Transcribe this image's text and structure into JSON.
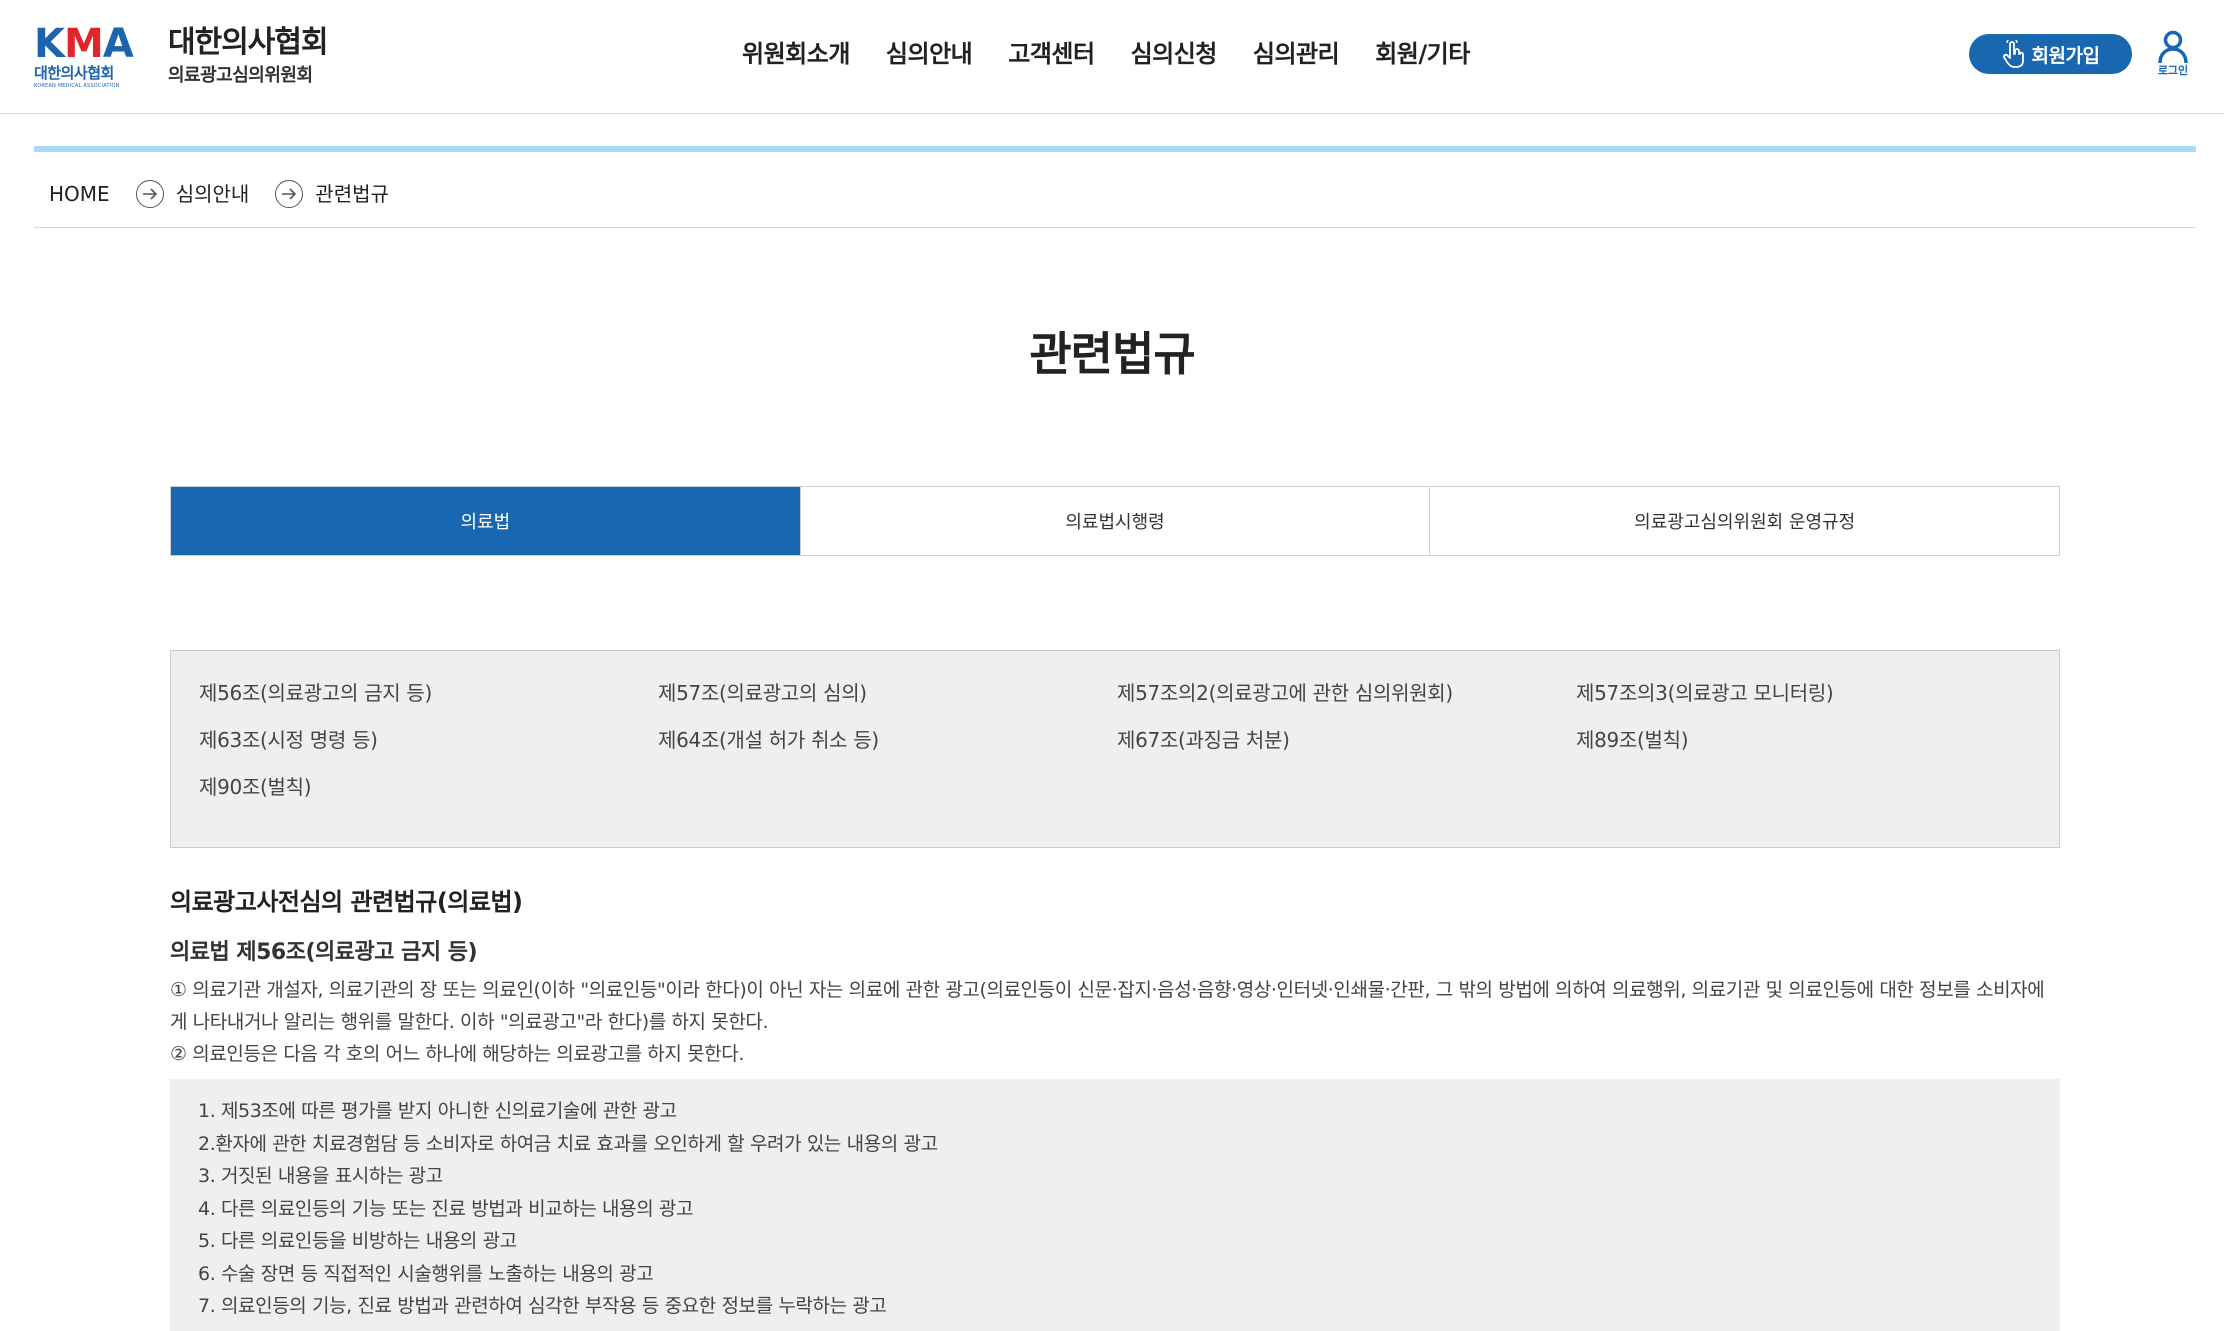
{
  "header": {
    "logo": {
      "abbr_left": "K",
      "abbr_mid": "M",
      "abbr_right": "A",
      "korean": "대한의사협회",
      "english": "KOREAN MEDICAL ASSOCIATION"
    },
    "org_title": "대한의사협회",
    "org_subtitle": "의료광고심의위원회",
    "nav": [
      "위원회소개",
      "심의안내",
      "고객센터",
      "심의신청",
      "심의관리",
      "회원/기타"
    ],
    "join_label": "회원가입",
    "login_label": "로그인",
    "colors": {
      "brand": "#1a67b1",
      "logo_red": "#e0262b",
      "crumb_bar": "#a9dbf5"
    }
  },
  "breadcrumb": [
    "HOME",
    "심의안내",
    "관련법규"
  ],
  "page_title": "관련법규",
  "tabs": [
    {
      "label": "의료법",
      "active": true
    },
    {
      "label": "의료법시행령",
      "active": false
    },
    {
      "label": "의료광고심의위원회 운영규정",
      "active": false
    }
  ],
  "articles": [
    "제56조(의료광고의 금지 등)",
    "제57조(의료광고의 심의)",
    "제57조의2(의료광고에 관한 심의위원회)",
    "제57조의3(의료광고 모니터링)",
    "제63조(시정 명령 등)",
    "제64조(개설 허가 취소 등)",
    "제67조(과징금 처분)",
    "제89조(벌칙)",
    "제90조(벌칙)"
  ],
  "content": {
    "section_title": "의료광고사전심의 관련법규(의료법)",
    "law_title": "의료법 제56조(의료광고 금지 등)",
    "para1": "① 의료기관 개설자, 의료기관의 장 또는 의료인(이하 \"의료인등\"이라 한다)이 아닌 자는 의료에 관한 광고(의료인등이 신문·잡지·음성·음향·영상·인터넷·인쇄물·간판, 그 밖의 방법에 의하여 의료행위, 의료기관 및 의료인등에 대한 정보를 소비자에게 나타내거나 알리는 행위를 말한다. 이하 \"의료광고\"라 한다)를 하지 못한다.",
    "para2": "② 의료인등은 다음 각 호의 어느 하나에 해당하는 의료광고를 하지 못한다.",
    "items": [
      "1. 제53조에 따른 평가를 받지 아니한 신의료기술에 관한 광고",
      "2.환자에 관한 치료경험담 등 소비자로 하여금 치료 효과를 오인하게 할 우려가 있는 내용의 광고",
      "3. 거짓된 내용을 표시하는 광고",
      "4. 다른 의료인등의 기능 또는 진료 방법과 비교하는 내용의 광고",
      "5. 다른 의료인등을 비방하는 내용의 광고",
      "6. 수술 장면 등 직접적인 시술행위를 노출하는 내용의 광고",
      "7. 의료인등의 기능, 진료 방법과 관련하여 심각한 부작용 등 중요한 정보를 누락하는 광고"
    ]
  }
}
